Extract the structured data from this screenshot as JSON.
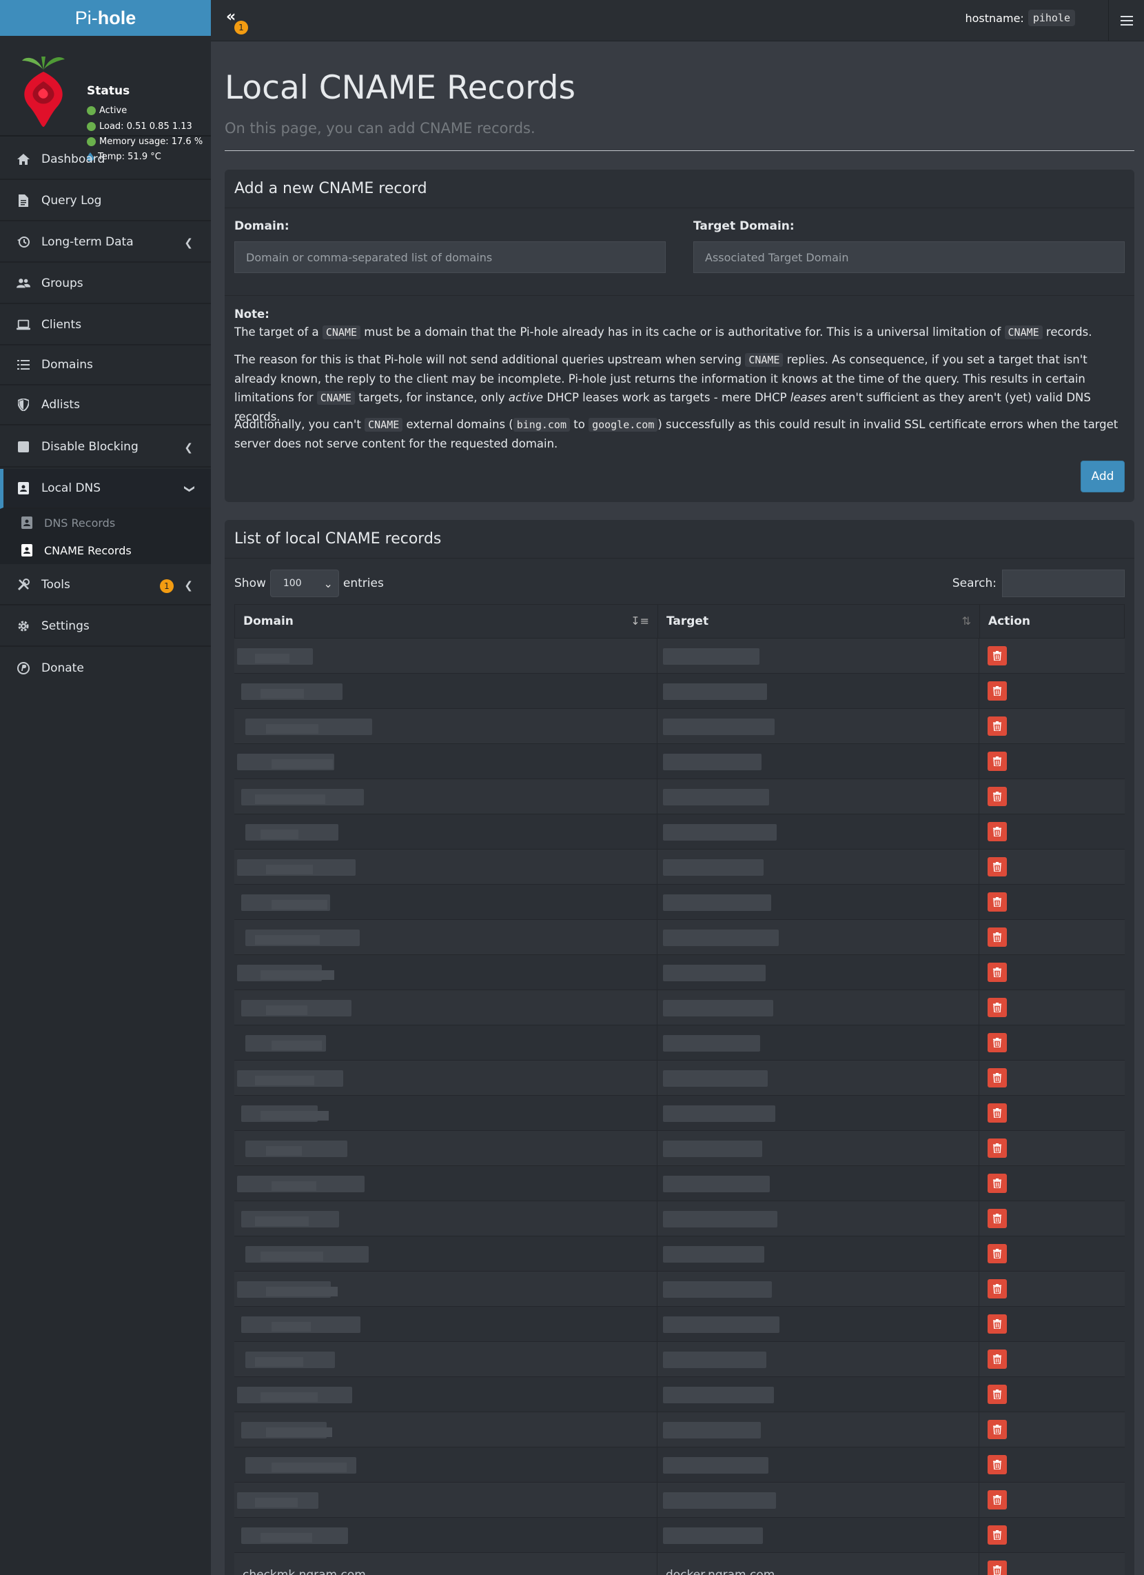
{
  "brand": {
    "light": "Pi-",
    "bold": "hole"
  },
  "status": {
    "title": "Status",
    "active": "Active",
    "load": "Load:  0.51  0.85  1.13",
    "memory": "Memory usage:  17.6 %",
    "temp": "Temp: 51.9 °C"
  },
  "sidebar": {
    "items": [
      {
        "label": "Dashboard",
        "icon": "home-icon"
      },
      {
        "label": "Query Log",
        "icon": "file-icon"
      },
      {
        "label": "Long-term Data",
        "icon": "history-icon"
      },
      {
        "label": "Groups",
        "icon": "users-icon"
      },
      {
        "label": "Clients",
        "icon": "laptop-icon"
      },
      {
        "label": "Domains",
        "icon": "list-icon"
      },
      {
        "label": "Adlists",
        "icon": "shield-icon"
      },
      {
        "label": "Disable Blocking",
        "icon": "stop-icon"
      },
      {
        "label": "Local DNS",
        "icon": "address-book-icon"
      },
      {
        "label": "Tools",
        "icon": "tools-icon",
        "badge": "1"
      },
      {
        "label": "Settings",
        "icon": "gear-icon"
      },
      {
        "label": "Donate",
        "icon": "paypal-icon"
      }
    ],
    "sub_items": [
      {
        "label": "DNS Records"
      },
      {
        "label": "CNAME Records"
      }
    ]
  },
  "topbar": {
    "collapse_badge": "1",
    "hostname_label": "hostname:",
    "hostname_value": "pihole"
  },
  "page": {
    "title": "Local CNAME Records",
    "subtitle": "On this page, you can add CNAME records."
  },
  "add_box": {
    "title": "Add a new CNAME record",
    "domain_label": "Domain:",
    "domain_placeholder": "Domain or comma-separated list of domains",
    "target_label": "Target Domain:",
    "target_placeholder": "Associated Target Domain",
    "note_title": "Note:",
    "note_p1_a": "The target of a ",
    "note_p1_code1": "CNAME",
    "note_p1_b": " must be a domain that the Pi-hole already has in its cache or is authoritative for. This is a universal limitation of ",
    "note_p1_code2": "CNAME",
    "note_p1_c": " records.",
    "note_p2_a": "The reason for this is that Pi-hole will not send additional queries upstream when serving ",
    "note_p2_code1": "CNAME",
    "note_p2_b": " replies. As consequence, if you set a target that isn't already known, the reply to the client may be incomplete. Pi-hole just returns the information it knows at the time of the query. This results in certain limitations for ",
    "note_p2_code2": "CNAME",
    "note_p2_c": " targets, for instance, only ",
    "note_p2_em1": "active",
    "note_p2_d": " DHCP leases work as targets - mere DHCP ",
    "note_p2_em2": "leases",
    "note_p2_e": " aren't sufficient as they aren't (yet) valid DNS records.",
    "note_p3_a": "Additionally, you can't ",
    "note_p3_code1": "CNAME",
    "note_p3_b": " external domains (",
    "note_p3_code2": "bing.com",
    "note_p3_c": " to ",
    "note_p3_code3": "google.com",
    "note_p3_d": ") successfully as this could result in invalid SSL certificate errors when the target server does not serve content for the requested domain.",
    "add_button": "Add"
  },
  "list_box": {
    "title": "List of local CNAME records",
    "show_label": "Show",
    "entries_label": "entries",
    "page_size": "100",
    "search_label": "Search:",
    "columns": [
      "Domain",
      "Target",
      "Action"
    ],
    "last_row": {
      "domain": "checkmk.ngram.com",
      "target": "docker.ngram.com"
    }
  }
}
